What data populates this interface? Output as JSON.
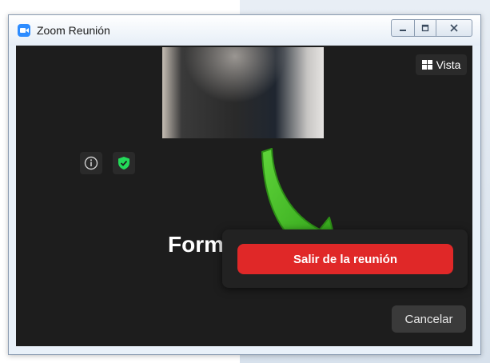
{
  "window": {
    "title": "Zoom Reunión"
  },
  "icons": {
    "app": "zoom-icon",
    "minimize": "minimize-icon",
    "maximize": "maximize-icon",
    "close": "close-icon",
    "view": "grid-icon",
    "info": "info-icon",
    "shield": "shield-check-icon",
    "arrow": "arrow-icon"
  },
  "meeting": {
    "view_label": "Vista",
    "heading_partial": "Form"
  },
  "dialog": {
    "leave_label": "Salir de la reunión",
    "cancel_label": "Cancelar"
  },
  "colors": {
    "leave": "#e02828",
    "shield": "#23d959",
    "arrow": "#34b51a",
    "background": "#1d1d1d"
  }
}
